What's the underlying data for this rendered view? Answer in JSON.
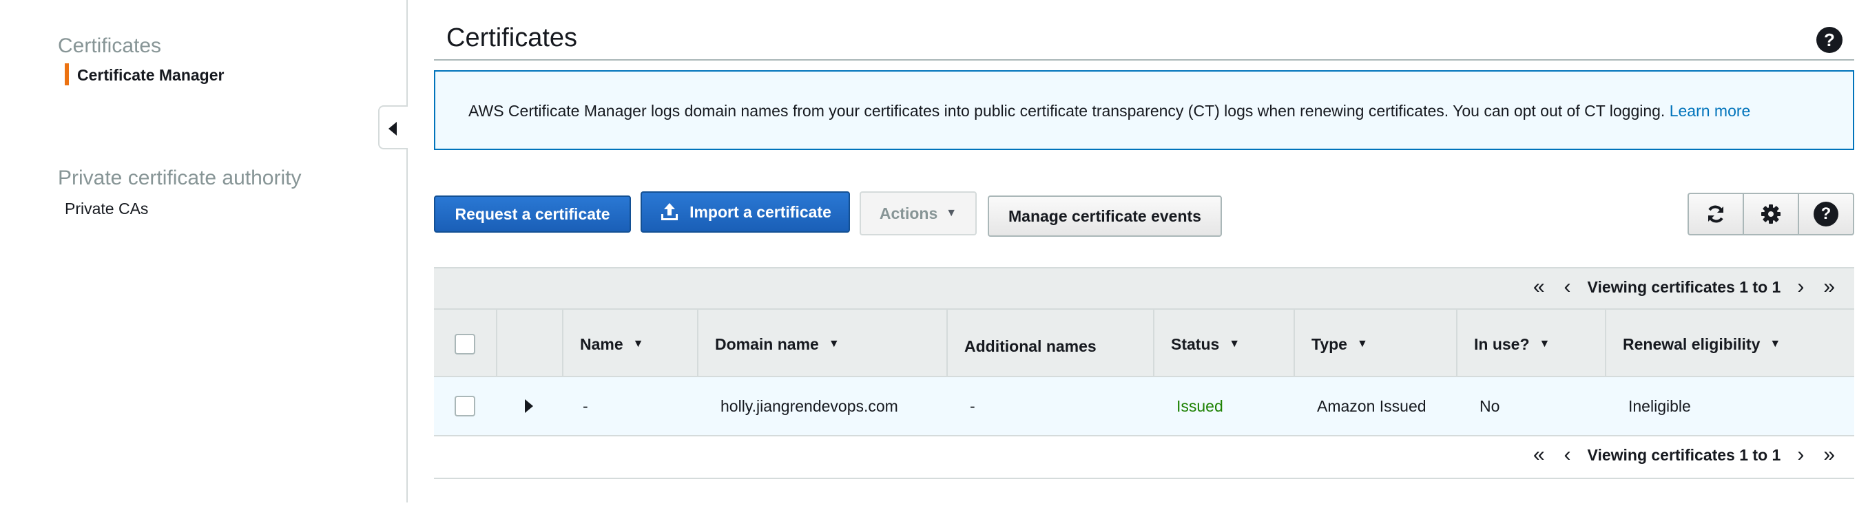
{
  "sidebar": {
    "section1_title": "Certificates",
    "section1_item": "Certificate Manager",
    "section2_title": "Private certificate authority",
    "section2_item": "Private CAs"
  },
  "main": {
    "title": "Certificates",
    "info_text": "AWS Certificate Manager logs domain names from your certificates into public certificate transparency (CT) logs when renewing certificates. You can opt out of CT logging.",
    "info_link": "Learn more"
  },
  "toolbar": {
    "request_label": "Request a certificate",
    "import_label": "Import a certificate",
    "actions_label": "Actions",
    "manage_label": "Manage certificate events"
  },
  "pager": {
    "text": "Viewing certificates 1 to 1"
  },
  "table": {
    "columns": {
      "name": "Name",
      "domain": "Domain name",
      "additional": "Additional names",
      "status": "Status",
      "type": "Type",
      "inuse": "In use?",
      "renewal": "Renewal eligibility"
    },
    "rows": [
      {
        "name": "-",
        "domain": "holly.jiangrendevops.com",
        "additional": "-",
        "status": "Issued",
        "type": "Amazon Issued",
        "inuse": "No",
        "renewal": "Ineligible"
      }
    ]
  },
  "colors": {
    "accent_orange": "#ec7211",
    "primary_blue": "#1a5fb7",
    "link_blue": "#0073bb",
    "status_green": "#1d8102"
  }
}
